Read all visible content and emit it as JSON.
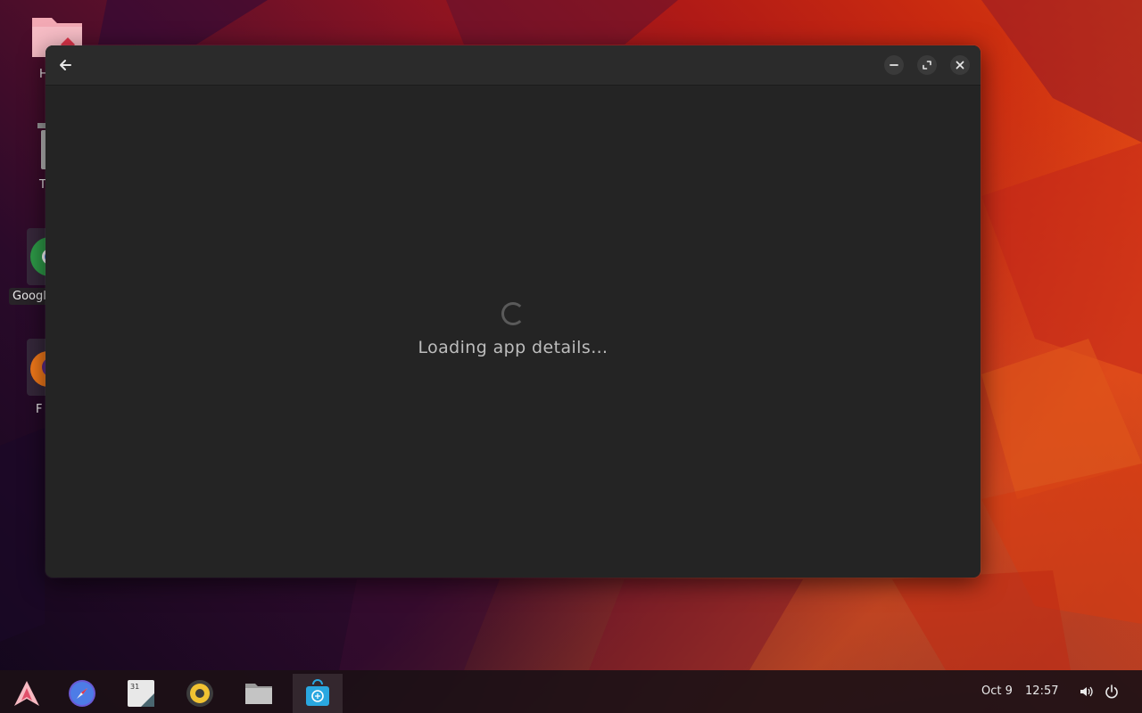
{
  "window": {
    "loading_text": "Loading app details…"
  },
  "desktop": {
    "icons": [
      {
        "label": "H",
        "icon": "home-folder-icon"
      },
      {
        "label": "T",
        "icon": "trash-icon"
      },
      {
        "label": "Googl",
        "icon": "chrome-icon"
      },
      {
        "label": "F",
        "icon": "firefox-icon"
      }
    ]
  },
  "taskbar": {
    "apps": [
      {
        "icon": "app-launcher-icon"
      },
      {
        "icon": "web-browser-icon"
      },
      {
        "icon": "calendar-icon",
        "text": "31"
      },
      {
        "icon": "music-player-icon"
      },
      {
        "icon": "files-icon"
      },
      {
        "icon": "software-center-icon",
        "active": true
      }
    ],
    "clock": {
      "date": "Oct 9",
      "time": "12:57"
    },
    "tray": [
      "volume-icon",
      "power-icon"
    ]
  },
  "colors": {
    "window_bg": "#242424",
    "headerbar_bg": "#2b2b2b",
    "active_indicator": "#f06a7a"
  }
}
